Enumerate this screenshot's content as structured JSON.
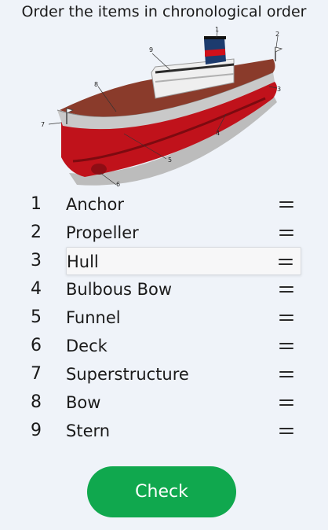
{
  "prompt": "Order the items in chronological order",
  "figure": {
    "labels": [
      "1",
      "2",
      "3",
      "4",
      "5",
      "6",
      "7",
      "8",
      "9"
    ]
  },
  "items": [
    {
      "number": "1",
      "label": "Anchor",
      "selected": false
    },
    {
      "number": "2",
      "label": "Propeller",
      "selected": false
    },
    {
      "number": "3",
      "label": "Hull",
      "selected": true
    },
    {
      "number": "4",
      "label": "Bulbous Bow",
      "selected": false
    },
    {
      "number": "5",
      "label": "Funnel",
      "selected": false
    },
    {
      "number": "6",
      "label": "Deck",
      "selected": false
    },
    {
      "number": "7",
      "label": "Superstructure",
      "selected": false
    },
    {
      "number": "8",
      "label": "Bow",
      "selected": false
    },
    {
      "number": "9",
      "label": "Stern",
      "selected": false
    }
  ],
  "check_button": {
    "label": "Check"
  },
  "colors": {
    "background": "#eff3f9",
    "accent": "#10a84e",
    "hull_red": "#c0121b",
    "deck_brown": "#8a3b2b"
  }
}
